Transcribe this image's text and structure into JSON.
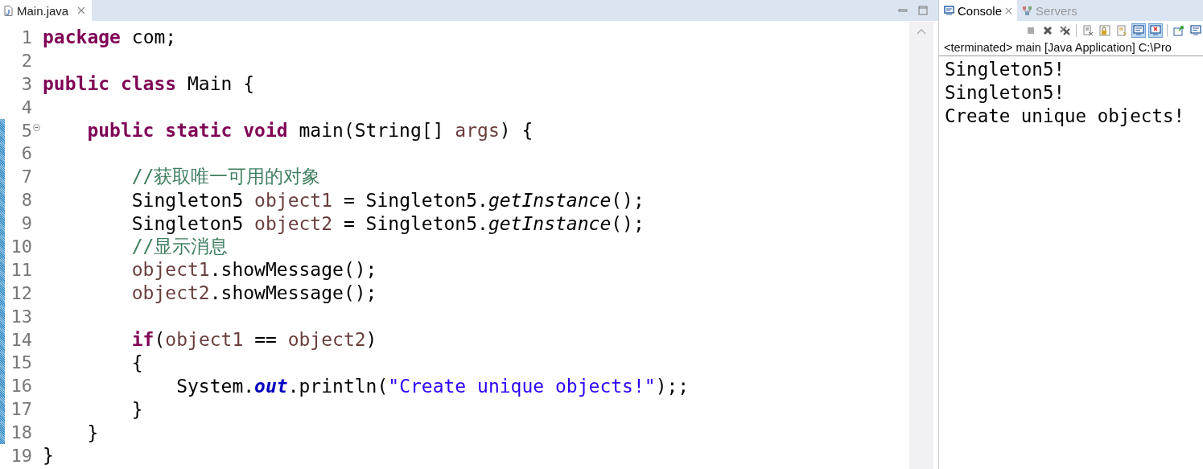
{
  "editor": {
    "tabs": [
      {
        "label": "Main.java",
        "selected": true
      }
    ],
    "lines": [
      {
        "number": "1",
        "marked": false,
        "fold": false,
        "tokens": [
          {
            "kind": "kw",
            "text": "package"
          },
          {
            "kind": "plain",
            "text": " com;"
          }
        ]
      },
      {
        "number": "2",
        "marked": false,
        "fold": false
      },
      {
        "number": "3",
        "marked": false,
        "fold": false,
        "tokens": [
          {
            "kind": "kw",
            "text": "public class"
          },
          {
            "kind": "plain",
            "text": " Main {"
          }
        ]
      },
      {
        "number": "4",
        "marked": false,
        "fold": false
      },
      {
        "number": "5",
        "marked": true,
        "fold": true,
        "tokens": [
          {
            "kind": "kw",
            "text": "    public static void"
          },
          {
            "kind": "plain",
            "text": " main(String[] "
          },
          {
            "kind": "var",
            "text": "args"
          },
          {
            "kind": "plain",
            "text": ") {"
          }
        ]
      },
      {
        "number": "6",
        "marked": true,
        "fold": false
      },
      {
        "number": "7",
        "marked": true,
        "fold": false,
        "tokens": [
          {
            "kind": "comment",
            "text": "        //获取唯一可用的对象"
          }
        ]
      },
      {
        "number": "8",
        "marked": true,
        "fold": false,
        "tokens": [
          {
            "kind": "plain",
            "text": "        Singleton5 "
          },
          {
            "kind": "var",
            "text": "object1"
          },
          {
            "kind": "plain",
            "text": " = Singleton5."
          },
          {
            "kind": "static",
            "text": "getInstance"
          },
          {
            "kind": "plain",
            "text": "();"
          }
        ]
      },
      {
        "number": "9",
        "marked": true,
        "fold": false,
        "tokens": [
          {
            "kind": "plain",
            "text": "        Singleton5 "
          },
          {
            "kind": "var",
            "text": "object2"
          },
          {
            "kind": "plain",
            "text": " = Singleton5."
          },
          {
            "kind": "static",
            "text": "getInstance"
          },
          {
            "kind": "plain",
            "text": "();"
          }
        ]
      },
      {
        "number": "10",
        "marked": true,
        "fold": false,
        "tokens": [
          {
            "kind": "comment",
            "text": "        //显示消息"
          }
        ]
      },
      {
        "number": "11",
        "marked": true,
        "fold": false,
        "tokens": [
          {
            "kind": "var",
            "text": "        object1"
          },
          {
            "kind": "plain",
            "text": ".showMessage();"
          }
        ]
      },
      {
        "number": "12",
        "marked": true,
        "fold": false,
        "tokens": [
          {
            "kind": "var",
            "text": "        object2"
          },
          {
            "kind": "plain",
            "text": ".showMessage();"
          }
        ]
      },
      {
        "number": "13",
        "marked": true,
        "fold": false
      },
      {
        "number": "14",
        "marked": true,
        "fold": false,
        "tokens": [
          {
            "kind": "kw",
            "text": "        if"
          },
          {
            "kind": "plain",
            "text": "("
          },
          {
            "kind": "var",
            "text": "object1"
          },
          {
            "kind": "plain",
            "text": " == "
          },
          {
            "kind": "var",
            "text": "object2"
          },
          {
            "kind": "plain",
            "text": ")"
          }
        ]
      },
      {
        "number": "15",
        "marked": true,
        "fold": false,
        "tokens": [
          {
            "kind": "plain",
            "text": "        {"
          }
        ]
      },
      {
        "number": "16",
        "marked": true,
        "fold": false,
        "tokens": [
          {
            "kind": "plain",
            "text": "            System."
          },
          {
            "kind": "field",
            "text": "out"
          },
          {
            "kind": "plain",
            "text": ".println("
          },
          {
            "kind": "string",
            "text": "\"Create unique objects!\""
          },
          {
            "kind": "plain",
            "text": ");;"
          }
        ]
      },
      {
        "number": "17",
        "marked": true,
        "fold": false,
        "tokens": [
          {
            "kind": "plain",
            "text": "        }"
          }
        ]
      },
      {
        "number": "18",
        "marked": true,
        "fold": false,
        "tokens": [
          {
            "kind": "plain",
            "text": "    }"
          }
        ]
      },
      {
        "number": "19",
        "marked": false,
        "fold": false,
        "tokens": [
          {
            "kind": "plain",
            "text": "}"
          }
        ]
      }
    ]
  },
  "console": {
    "tabs": [
      {
        "label": "Console",
        "selected": true,
        "kind": "console"
      },
      {
        "label": "Servers",
        "selected": false,
        "kind": "servers"
      }
    ],
    "toolbar": [
      {
        "kind": "stop",
        "pressed": false
      },
      {
        "kind": "remove",
        "pressed": false
      },
      {
        "kind": "remove-all",
        "pressed": false
      },
      {
        "kind": "divider"
      },
      {
        "kind": "clear",
        "pressed": false
      },
      {
        "kind": "lock",
        "pressed": false
      },
      {
        "kind": "wrap",
        "pressed": false
      },
      {
        "kind": "stdout",
        "pressed": true
      },
      {
        "kind": "stderr",
        "pressed": true
      },
      {
        "kind": "divider"
      },
      {
        "kind": "pin",
        "pressed": false
      },
      {
        "kind": "display",
        "pressed": false
      }
    ],
    "status": "<terminated> main [Java Application] C:\\Pro",
    "output": [
      "Singleton5!",
      "Singleton5!",
      "Create unique objects!"
    ]
  }
}
